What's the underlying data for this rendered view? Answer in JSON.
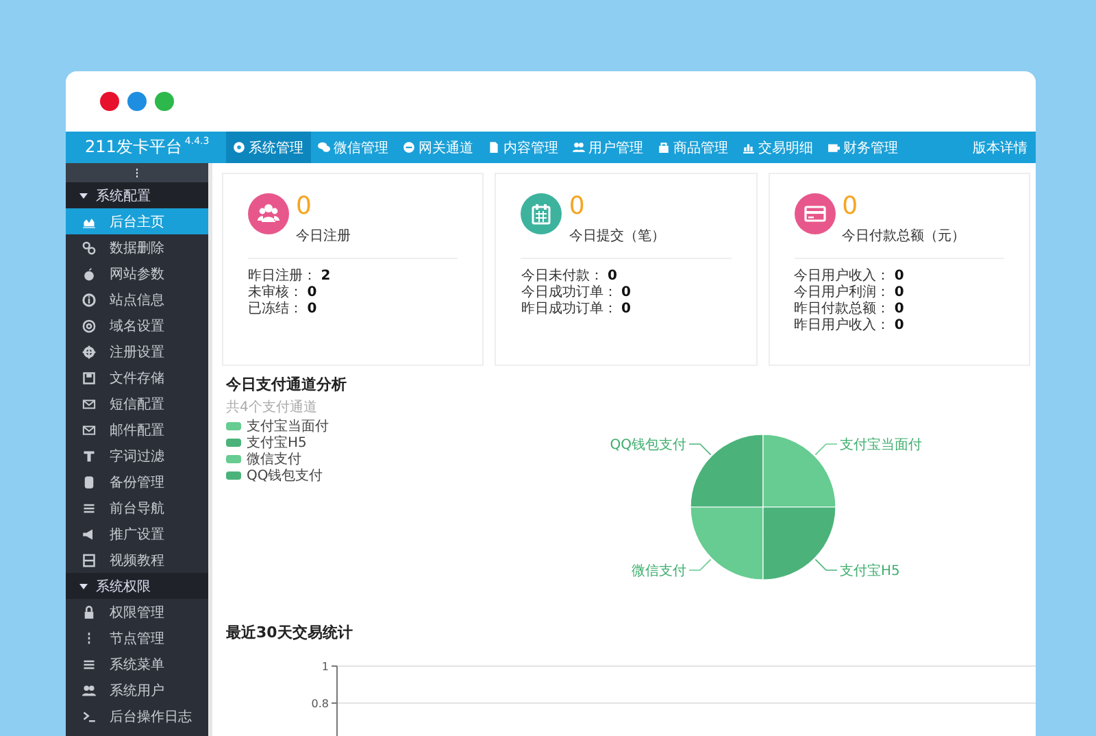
{
  "window": {
    "controls": [
      {
        "color": "#e8112d"
      },
      {
        "color": "#1e8fe0"
      },
      {
        "color": "#2db84b"
      }
    ]
  },
  "navbar": {
    "brand": "211发卡平台",
    "version": "4.4.3",
    "items": [
      {
        "label": "系统管理",
        "selected": true
      },
      {
        "label": "微信管理",
        "selected": false
      },
      {
        "label": "网关通道",
        "selected": false
      },
      {
        "label": "内容管理",
        "selected": false
      },
      {
        "label": "用户管理",
        "selected": false
      },
      {
        "label": "商品管理",
        "selected": false
      },
      {
        "label": "交易明细",
        "selected": false
      },
      {
        "label": "财务管理",
        "selected": false
      }
    ],
    "right_link": "版本详情"
  },
  "sidebar": {
    "groups": [
      {
        "label": "系统配置",
        "expanded": true,
        "items": [
          {
            "label": "后台主页",
            "selected": true
          },
          {
            "label": "数据删除",
            "selected": false
          },
          {
            "label": "网站参数",
            "selected": false
          },
          {
            "label": "站点信息",
            "selected": false
          },
          {
            "label": "域名设置",
            "selected": false
          },
          {
            "label": "注册设置",
            "selected": false
          },
          {
            "label": "文件存储",
            "selected": false
          },
          {
            "label": "短信配置",
            "selected": false
          },
          {
            "label": "邮件配置",
            "selected": false
          },
          {
            "label": "字词过滤",
            "selected": false
          },
          {
            "label": "备份管理",
            "selected": false
          },
          {
            "label": "前台导航",
            "selected": false
          },
          {
            "label": "推广设置",
            "selected": false
          },
          {
            "label": "视频教程",
            "selected": false
          }
        ]
      },
      {
        "label": "系统权限",
        "expanded": true,
        "items": [
          {
            "label": "权限管理",
            "selected": false
          },
          {
            "label": "节点管理",
            "selected": false
          },
          {
            "label": "系统菜单",
            "selected": false
          },
          {
            "label": "系统用户",
            "selected": false
          },
          {
            "label": "后台操作日志",
            "selected": false
          }
        ]
      }
    ]
  },
  "stat_cards": [
    {
      "kind": "users",
      "color": "#e8578b",
      "value": "0",
      "label": "今日注册",
      "stats": [
        {
          "label": "昨日注册：",
          "value": "2"
        },
        {
          "label": "未审核：",
          "value": "0"
        },
        {
          "label": "已冻结：",
          "value": "0"
        }
      ]
    },
    {
      "kind": "calendar",
      "color": "#3db39e",
      "value": "0",
      "label": "今日提交（笔）",
      "stats": [
        {
          "label": "今日未付款：",
          "value": "0"
        },
        {
          "label": "今日成功订单：",
          "value": "0"
        },
        {
          "label": "昨日成功订单：",
          "value": "0"
        }
      ]
    },
    {
      "kind": "card",
      "color": "#e8578b",
      "value": "0",
      "label": "今日付款总额（元）",
      "stats": [
        {
          "label": "今日用户收入：",
          "value": "0"
        },
        {
          "label": "今日用户利润：",
          "value": "0"
        },
        {
          "label": "昨日付款总额：",
          "value": "0"
        },
        {
          "label": "昨日用户收入：",
          "value": "0"
        }
      ]
    }
  ],
  "channel_analysis": {
    "title": "今日支付通道分析",
    "subtitle": "共4个支付通道",
    "legend": [
      {
        "name": "支付宝当面付",
        "color": "#66cc91"
      },
      {
        "name": "支付宝H5",
        "color": "#4bb37a"
      },
      {
        "name": "微信支付",
        "color": "#66cc91"
      },
      {
        "name": "QQ钱包支付",
        "color": "#4bb37a"
      }
    ],
    "pie_slices": [
      {
        "label": "QQ钱包支付",
        "color": "#4bb37a"
      },
      {
        "label": "支付宝当面付",
        "color": "#66cc91"
      },
      {
        "label": "微信支付",
        "color": "#66cc91"
      },
      {
        "label": "支付宝H5",
        "color": "#4bb37a"
      }
    ]
  },
  "trade_stats": {
    "title": "最近30天交易统计",
    "y_axis_labels": [
      "1",
      "0.8"
    ]
  }
}
